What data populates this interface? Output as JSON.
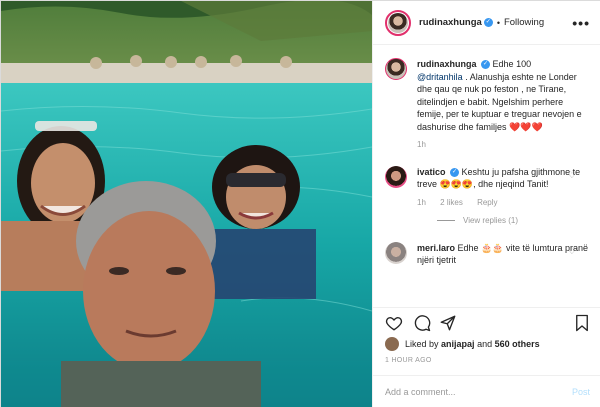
{
  "header": {
    "username": "rudinaxhunga",
    "separator": "•",
    "follow_label": "Following",
    "more_label": "•••"
  },
  "caption": {
    "username": "rudinaxhunga",
    "lead": "Edhe 100",
    "mention": "@dritanhila",
    "text": ". Alanushja eshte ne Londer dhe qau qe nuk po feston , ne Tirane, ditelindjen e babit. Ngelshim perhere femije, per te kuptuar e treguar nevojen e dashurise dhe familjes",
    "emoji": "❤️❤️❤️",
    "time": "1h"
  },
  "comments": [
    {
      "username": "ivatico",
      "text": "Keshtu ju pafsha gjithmone te treve 😍😍😍, dhe njeqind Tanit!",
      "time": "1h",
      "likes": "2 likes",
      "reply_label": "Reply",
      "view_replies": "View replies (1)"
    },
    {
      "username": "meri.laro",
      "text": "Edhe 🎂🎂 vite të lumtura pranë njëri tjetrit"
    }
  ],
  "likes": {
    "prefix": "Liked by",
    "user": "anijapaj",
    "middle": "and",
    "count": "560 others"
  },
  "posted": "1 HOUR AGO",
  "add_comment": {
    "placeholder": "Add a comment...",
    "post_label": "Post"
  },
  "colors": {
    "verified": "#3897f0",
    "heart": "#ed4956",
    "link": "#003569",
    "muted": "#999999"
  }
}
